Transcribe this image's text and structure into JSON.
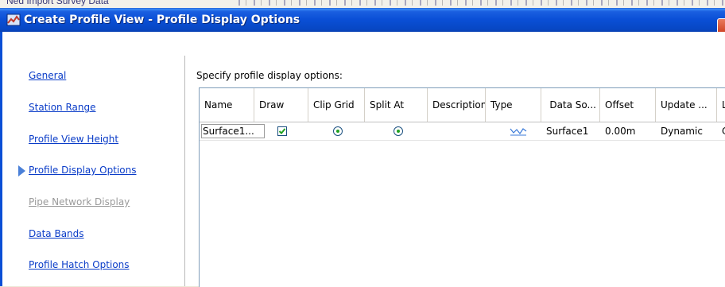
{
  "background_toolbar": {
    "text": "Ned Import Survey Data"
  },
  "window": {
    "title": "Create Profile View - Profile Display Options",
    "title_bar_color": "#0a4fd6"
  },
  "sidebar": {
    "items": [
      {
        "label": "General",
        "state": "enabled"
      },
      {
        "label": "Station Range",
        "state": "enabled"
      },
      {
        "label": "Profile View Height",
        "state": "enabled"
      },
      {
        "label": "Profile Display Options",
        "state": "current"
      },
      {
        "label": "Pipe Network Display",
        "state": "disabled"
      },
      {
        "label": "Data Bands",
        "state": "enabled"
      },
      {
        "label": "Profile Hatch Options",
        "state": "enabled"
      }
    ],
    "current_indicator_icon": "right-arrow-icon"
  },
  "main": {
    "instruction": "Specify profile display options:",
    "table": {
      "columns": [
        "Name",
        "Draw",
        "Clip Grid",
        "Split At",
        "Description",
        "Type",
        "Data So...",
        "Offset",
        "Update ...",
        "La"
      ],
      "rows": [
        {
          "name": "Surface1...",
          "draw": true,
          "clip_grid": true,
          "split_at": true,
          "description": "",
          "type_icon": "surface-profile-icon",
          "data_source": "Surface1",
          "offset": "0.00m",
          "update_mode": "Dynamic",
          "layer": "C-I"
        }
      ]
    }
  },
  "colors": {
    "link": "#0a3cc8",
    "disabled_link": "#9a9a9a",
    "radio_dot": "#21a121",
    "check_mark": "#21a121"
  }
}
